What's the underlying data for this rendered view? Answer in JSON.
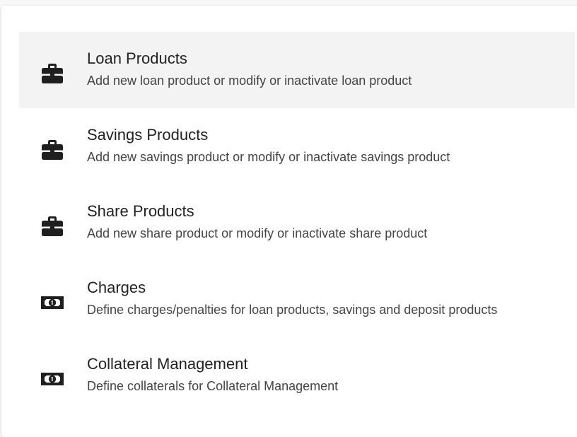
{
  "items": [
    {
      "title": "Loan Products",
      "description": "Add new loan product or modify or inactivate loan product",
      "icon": "briefcase-icon",
      "active": true
    },
    {
      "title": "Savings Products",
      "description": "Add new savings product or modify or inactivate savings product",
      "icon": "briefcase-icon",
      "active": false
    },
    {
      "title": "Share Products",
      "description": "Add new share product or modify or inactivate share product",
      "icon": "briefcase-icon",
      "active": false
    },
    {
      "title": "Charges",
      "description": "Define charges/penalties for loan products, savings and deposit products",
      "icon": "money-bill-icon",
      "active": false
    },
    {
      "title": "Collateral Management",
      "description": "Define collaterals for Collateral Management",
      "icon": "money-bill-icon",
      "active": false
    }
  ],
  "colors": {
    "active_row_bg": "#f3f3f3",
    "icon": "#1f1f1f",
    "title": "#222222",
    "description": "#444444"
  }
}
